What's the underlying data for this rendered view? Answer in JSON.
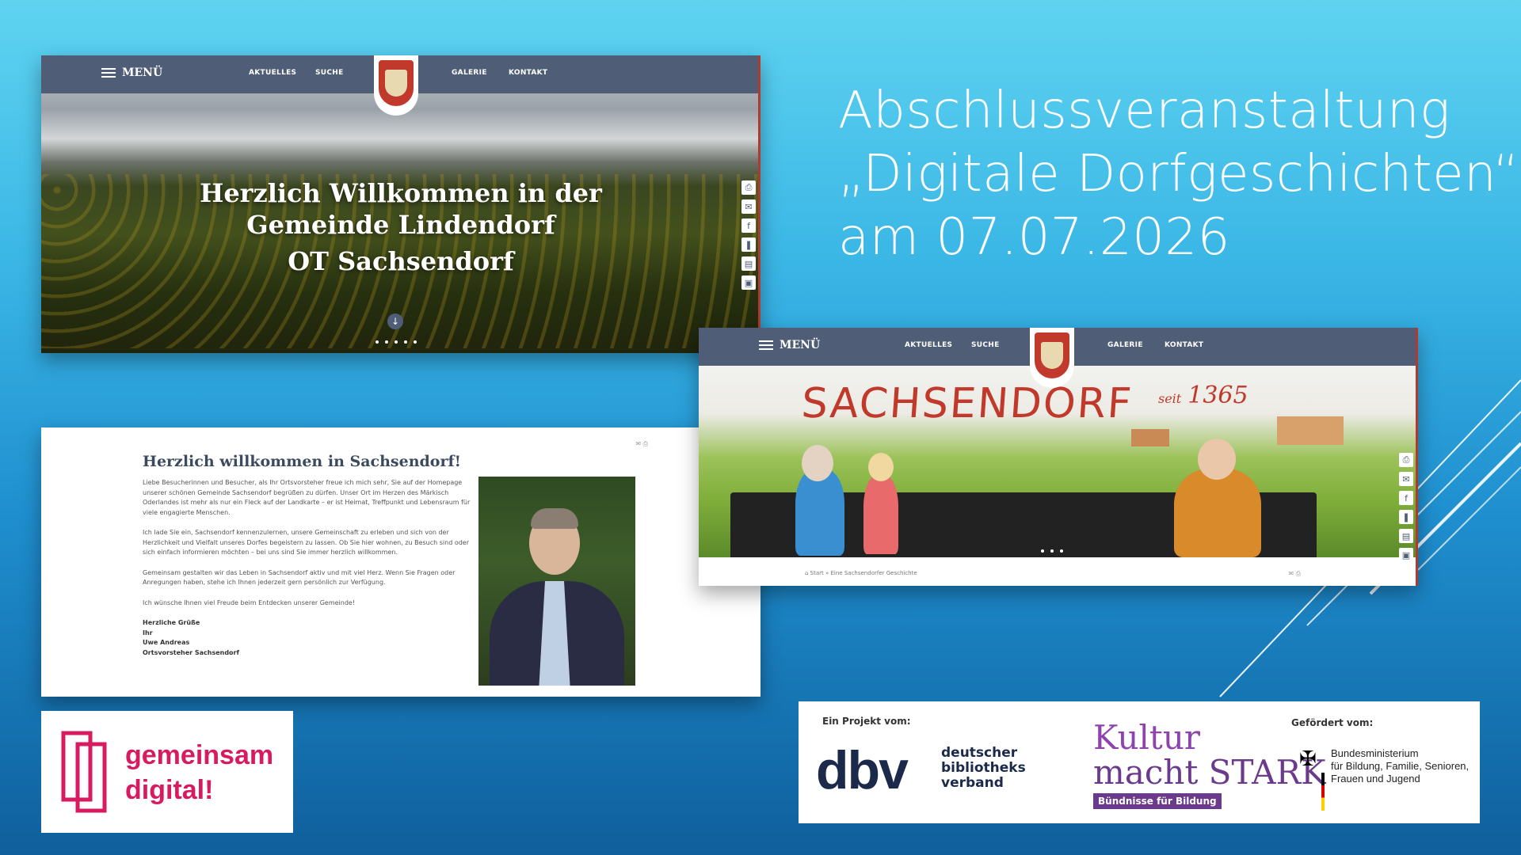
{
  "slide": {
    "title_lines": [
      "Abschlussveranstaltung",
      "„Digitale Dorfgeschichten“",
      "am 07.07.2026"
    ]
  },
  "site_nav": {
    "menu_label": "MENÜ",
    "links": [
      "AKTUELLES",
      "SUCHE",
      "GALERIE",
      "KONTAKT"
    ]
  },
  "screenshot_home": {
    "hero_lines": [
      "Herzlich Willkommen in der",
      "Gemeinde Lindendorf",
      "OT Sachsendorf"
    ]
  },
  "screenshot_welcome": {
    "heading": "Herzlich willkommen in Sachsendorf!",
    "paragraphs": [
      "Liebe Besucherinnen und Besucher, als Ihr Ortsvorsteher freue ich mich sehr, Sie auf der Homepage unserer schönen Gemeinde Sachsendorf begrüßen zu dürfen. Unser Ort im Herzen des Märkisch Oderlandes ist mehr als nur ein Fleck auf der Landkarte – er ist Heimat, Treffpunkt und Lebensraum für viele engagierte Menschen.",
      "Ich lade Sie ein, Sachsendorf kennenzulernen, unsere Gemeinschaft zu erleben und sich von der Herzlichkeit und Vielfalt unseres Dorfes begeistern zu lassen. Ob Sie hier wohnen, zu Besuch sind oder sich einfach informieren möchten – bei uns sind Sie immer herzlich willkommen.",
      "Gemeinsam gestalten wir das Leben in Sachsendorf aktiv und mit viel Herz. Wenn Sie Fragen oder Anregungen haben, stehe ich Ihnen jederzeit gern persönlich zur Verfügung.",
      "Ich wünsche Ihnen viel Freude beim Entdecken unserer Gemeinde!"
    ],
    "signature": [
      "Herzliche Grüße",
      "Ihr",
      "Uwe Andreas",
      "Ortsvorsteher Sachsendorf"
    ]
  },
  "screenshot_story": {
    "mural_title": "SACHSENDORF",
    "mural_since_word": "seit",
    "mural_since_year": "1365",
    "breadcrumb": "⌂ Start » Eine Sachsendorfer Geschichte"
  },
  "logos": {
    "gemeinsam_digital": [
      "gemeinsam",
      "digital!"
    ],
    "project_label": "Ein Projekt vom:",
    "dbv_short": "dbv",
    "dbv_long": [
      "deutscher",
      "bibliotheks",
      "verband"
    ],
    "kultur_lines": [
      "Kultur",
      "macht STARK"
    ],
    "kultur_badge": "Bündnisse für Bildung",
    "funded_label": "Gefördert vom:",
    "ministry_lines": [
      "Bundesministerium",
      "für Bildung, Familie, Senioren,",
      "Frauen und Jugend"
    ]
  },
  "colors": {
    "nav_bg": "#4f5d76",
    "accent_red": "#c0392b",
    "gd_pink": "#d81b60",
    "dbv_navy": "#1b2a4a",
    "kultur_purple": "#6b3a8c"
  },
  "icons": [
    "printer-icon",
    "mail-icon",
    "facebook-icon",
    "bookmark-icon",
    "contact-card-icon",
    "id-card-icon"
  ]
}
